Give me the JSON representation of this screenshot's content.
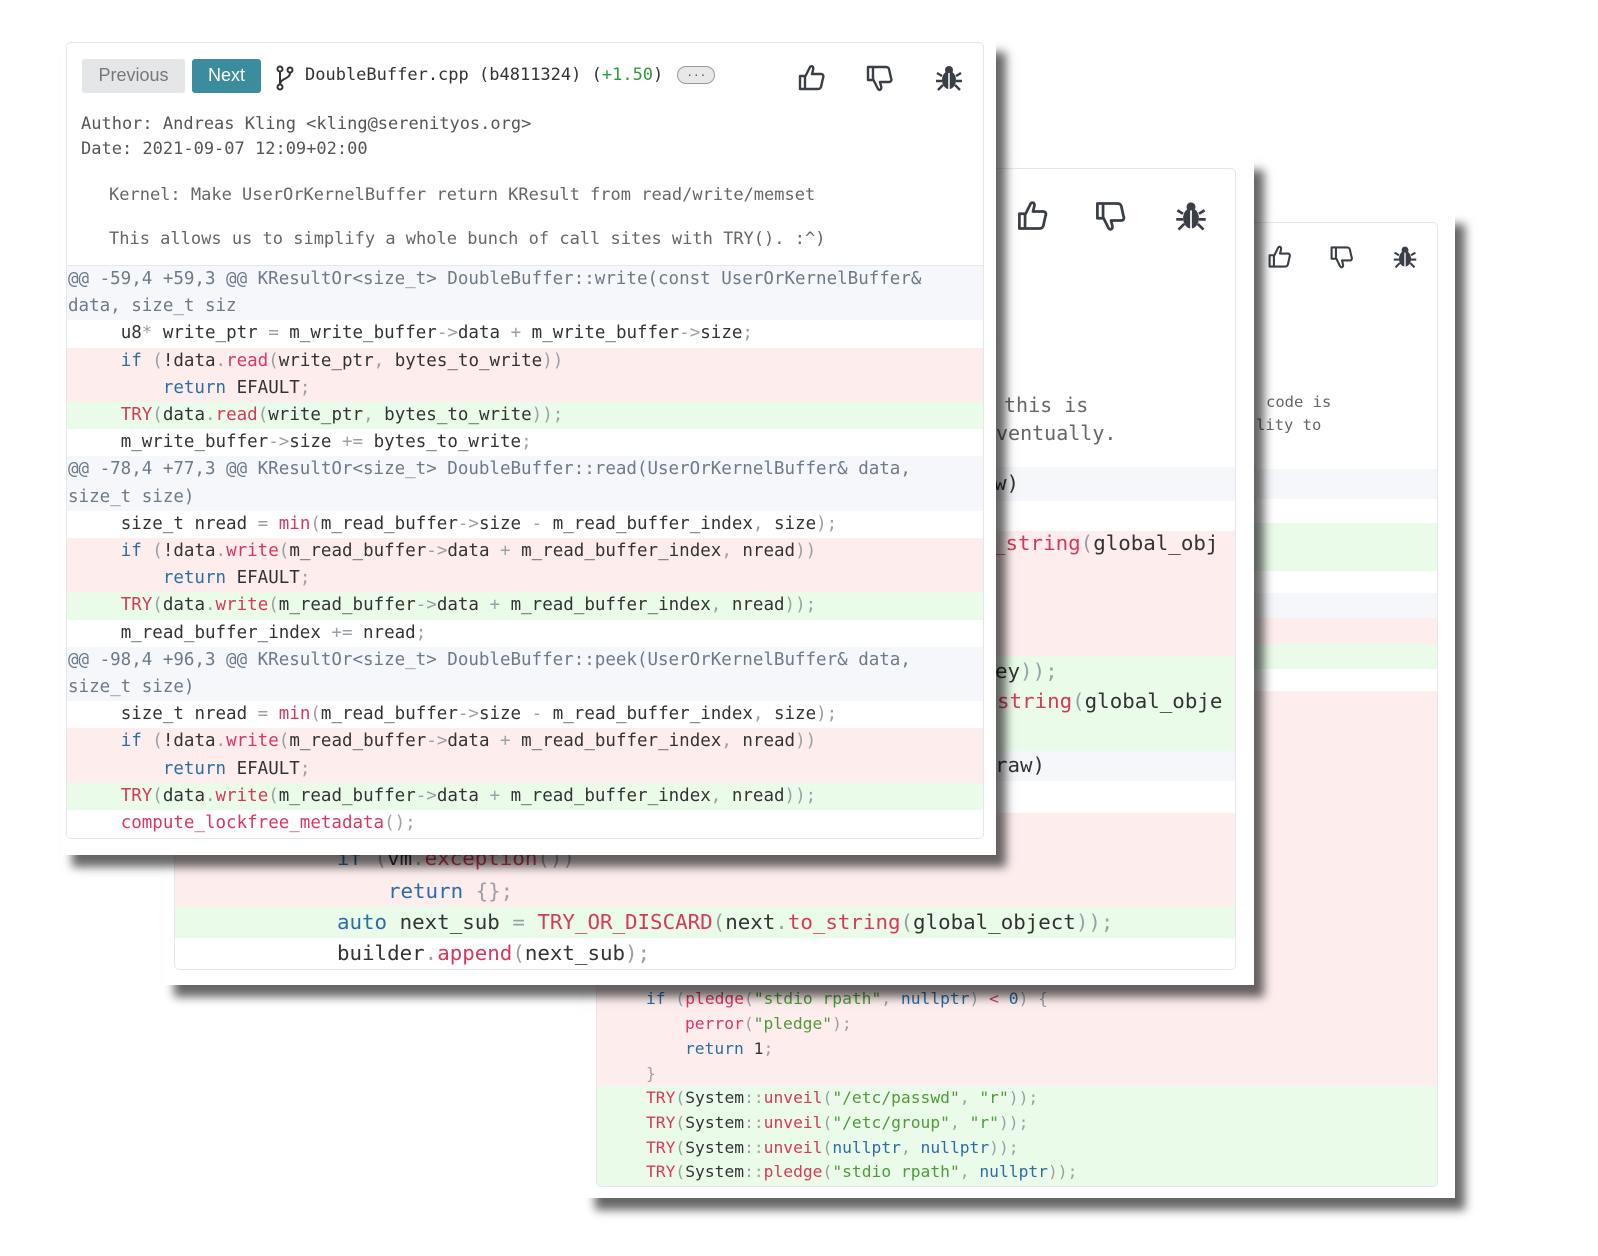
{
  "colors": {
    "accent": "#3b8c9c",
    "added_bg": "#ebfbea",
    "removed_bg": "#fdeded",
    "hunk_bg": "#f5f7fa",
    "keyword": "#2b6ea6",
    "function": "#d8385e",
    "string": "#4f9a3a",
    "score": "#2f9a3a"
  },
  "card1": {
    "prev_label": "Previous",
    "next_label": "Next",
    "branch_icon": "git-branch-icon",
    "file": "DoubleBuffer.cpp",
    "commit": "(b4811324)",
    "score": "+1.50",
    "more_label": "...",
    "icons": [
      "thumbs-up-icon",
      "thumbs-down-icon",
      "bug-icon"
    ],
    "author": "Author: Andreas Kling <kling@serenityos.org>",
    "date": "Date: 2021-09-07 12:09+02:00",
    "message": [
      "Kernel: Make UserOrKernelBuffer return KResult from read/write/memset",
      "This allows us to simplify a whole bunch of call sites with TRY(). :^)"
    ],
    "lines": [
      {
        "type": "hunk",
        "tokens": [
          [
            "@@ -59,4 +59,3 @@ KResultOr<size_t> DoubleBuffer::write(const UserOrKernelBuffer& data, size_t siz",
            ""
          ]
        ]
      },
      {
        "type": "ctx",
        "tokens": [
          [
            "     u8",
            ""
          ],
          [
            "*",
            "p"
          ],
          [
            " write_ptr ",
            ""
          ],
          [
            "=",
            "p"
          ],
          [
            " m_write_buffer",
            ""
          ],
          [
            "->",
            "p"
          ],
          [
            "data ",
            ""
          ],
          [
            "+",
            "p"
          ],
          [
            " m_write_buffer",
            ""
          ],
          [
            "->",
            "p"
          ],
          [
            "size",
            ""
          ],
          [
            ";",
            "p"
          ]
        ]
      },
      {
        "type": "del",
        "tokens": [
          [
            "     ",
            ""
          ],
          [
            "if",
            "k"
          ],
          [
            " (",
            "p"
          ],
          [
            "!data",
            ""
          ],
          [
            ".",
            "p"
          ],
          [
            "read",
            "f"
          ],
          [
            "(",
            "p"
          ],
          [
            "write_ptr",
            ""
          ],
          [
            ", ",
            "p"
          ],
          [
            "bytes_to_write",
            ""
          ],
          [
            "))",
            "p"
          ]
        ]
      },
      {
        "type": "del",
        "tokens": [
          [
            "         ",
            ""
          ],
          [
            "return",
            "k"
          ],
          [
            " EFAULT",
            ""
          ],
          [
            ";",
            "p"
          ]
        ]
      },
      {
        "type": "add",
        "tokens": [
          [
            "     ",
            ""
          ],
          [
            "TRY",
            "f"
          ],
          [
            "(",
            "p"
          ],
          [
            "data",
            ""
          ],
          [
            ".",
            "p"
          ],
          [
            "read",
            "f"
          ],
          [
            "(",
            "p"
          ],
          [
            "write_ptr",
            ""
          ],
          [
            ", ",
            "p"
          ],
          [
            "bytes_to_write",
            ""
          ],
          [
            "));",
            "p"
          ]
        ]
      },
      {
        "type": "ctx",
        "tokens": [
          [
            "     m_write_buffer",
            ""
          ],
          [
            "->",
            "p"
          ],
          [
            "size ",
            ""
          ],
          [
            "+=",
            "p"
          ],
          [
            " bytes_to_write",
            ""
          ],
          [
            ";",
            "p"
          ]
        ]
      },
      {
        "type": "hunk",
        "tokens": [
          [
            "@@ -78,4 +77,3 @@ KResultOr<size_t> DoubleBuffer::read(UserOrKernelBuffer& data, size_t size)",
            ""
          ]
        ]
      },
      {
        "type": "ctx",
        "tokens": [
          [
            "     size_t nread ",
            ""
          ],
          [
            "=",
            "p"
          ],
          [
            " ",
            ""
          ],
          [
            "min",
            "f"
          ],
          [
            "(",
            "p"
          ],
          [
            "m_read_buffer",
            ""
          ],
          [
            "->",
            "p"
          ],
          [
            "size ",
            ""
          ],
          [
            "-",
            "p"
          ],
          [
            " m_read_buffer_index",
            ""
          ],
          [
            ", ",
            "p"
          ],
          [
            "size",
            ""
          ],
          [
            ");",
            "p"
          ]
        ]
      },
      {
        "type": "del",
        "tokens": [
          [
            "     ",
            ""
          ],
          [
            "if",
            "k"
          ],
          [
            " (",
            "p"
          ],
          [
            "!data",
            ""
          ],
          [
            ".",
            "p"
          ],
          [
            "write",
            "f"
          ],
          [
            "(",
            "p"
          ],
          [
            "m_read_buffer",
            ""
          ],
          [
            "->",
            "p"
          ],
          [
            "data ",
            ""
          ],
          [
            "+",
            "p"
          ],
          [
            " m_read_buffer_index",
            ""
          ],
          [
            ", ",
            "p"
          ],
          [
            "nread",
            ""
          ],
          [
            "))",
            "p"
          ]
        ]
      },
      {
        "type": "del",
        "tokens": [
          [
            "         ",
            ""
          ],
          [
            "return",
            "k"
          ],
          [
            " EFAULT",
            ""
          ],
          [
            ";",
            "p"
          ]
        ]
      },
      {
        "type": "add",
        "tokens": [
          [
            "     ",
            ""
          ],
          [
            "TRY",
            "f"
          ],
          [
            "(",
            "p"
          ],
          [
            "data",
            ""
          ],
          [
            ".",
            "p"
          ],
          [
            "write",
            "f"
          ],
          [
            "(",
            "p"
          ],
          [
            "m_read_buffer",
            ""
          ],
          [
            "->",
            "p"
          ],
          [
            "data ",
            ""
          ],
          [
            "+",
            "p"
          ],
          [
            " m_read_buffer_index",
            ""
          ],
          [
            ", ",
            "p"
          ],
          [
            "nread",
            ""
          ],
          [
            "));",
            "p"
          ]
        ]
      },
      {
        "type": "ctx",
        "tokens": [
          [
            "     m_read_buffer_index ",
            ""
          ],
          [
            "+=",
            "p"
          ],
          [
            " nread",
            ""
          ],
          [
            ";",
            "p"
          ]
        ]
      },
      {
        "type": "hunk",
        "tokens": [
          [
            "@@ -98,4 +96,3 @@ KResultOr<size_t> DoubleBuffer::peek(UserOrKernelBuffer& data, size_t size)",
            ""
          ]
        ]
      },
      {
        "type": "ctx",
        "tokens": [
          [
            "     size_t nread ",
            ""
          ],
          [
            "=",
            "p"
          ],
          [
            " ",
            ""
          ],
          [
            "min",
            "f"
          ],
          [
            "(",
            "p"
          ],
          [
            "m_read_buffer",
            ""
          ],
          [
            "->",
            "p"
          ],
          [
            "size ",
            ""
          ],
          [
            "-",
            "p"
          ],
          [
            " m_read_buffer_index",
            ""
          ],
          [
            ", ",
            "p"
          ],
          [
            "size",
            ""
          ],
          [
            ");",
            "p"
          ]
        ]
      },
      {
        "type": "del",
        "tokens": [
          [
            "     ",
            ""
          ],
          [
            "if",
            "k"
          ],
          [
            " (",
            "p"
          ],
          [
            "!data",
            ""
          ],
          [
            ".",
            "p"
          ],
          [
            "write",
            "f"
          ],
          [
            "(",
            "p"
          ],
          [
            "m_read_buffer",
            ""
          ],
          [
            "->",
            "p"
          ],
          [
            "data ",
            ""
          ],
          [
            "+",
            "p"
          ],
          [
            " m_read_buffer_index",
            ""
          ],
          [
            ", ",
            "p"
          ],
          [
            "nread",
            ""
          ],
          [
            "))",
            "p"
          ]
        ]
      },
      {
        "type": "del",
        "tokens": [
          [
            "         ",
            ""
          ],
          [
            "return",
            "k"
          ],
          [
            " EFAULT",
            ""
          ],
          [
            ";",
            "p"
          ]
        ]
      },
      {
        "type": "add",
        "tokens": [
          [
            "     ",
            ""
          ],
          [
            "TRY",
            "f"
          ],
          [
            "(",
            "p"
          ],
          [
            "data",
            ""
          ],
          [
            ".",
            "p"
          ],
          [
            "write",
            "f"
          ],
          [
            "(",
            "p"
          ],
          [
            "m_read_buffer",
            ""
          ],
          [
            "->",
            "p"
          ],
          [
            "data ",
            ""
          ],
          [
            "+",
            "p"
          ],
          [
            " m_read_buffer_index",
            ""
          ],
          [
            ", ",
            "p"
          ],
          [
            "nread",
            ""
          ],
          [
            "));",
            "p"
          ]
        ]
      },
      {
        "type": "ctx",
        "tokens": [
          [
            "     ",
            ""
          ],
          [
            "compute_lockfree_metadata",
            "f"
          ],
          [
            "();",
            "p"
          ]
        ]
      }
    ]
  },
  "card2": {
    "icons": [
      "thumbs-up-icon",
      "thumbs-down-icon",
      "bug-icon"
    ],
    "message_fragments": [
      [
        [
          "this is",
          ""
        ]
      ],
      [
        [
          "ventually.",
          ""
        ]
      ]
    ],
    "fragments": [
      [
        [
          "w)",
          ""
        ]
      ],
      [
        [
          "_string",
          "f"
        ],
        [
          "(",
          "p"
        ],
        [
          "global_obj",
          ""
        ]
      ],
      [
        [
          "ey",
          ""
        ],
        [
          "));",
          "p"
        ]
      ],
      [
        [
          "string",
          "f"
        ],
        [
          "(",
          "p"
        ],
        [
          "global_obje",
          ""
        ]
      ],
      [
        [
          "raw)",
          ""
        ]
      ],
      [
        [
          "if",
          "k"
        ],
        [
          " (",
          "p"
        ],
        [
          "vm",
          ""
        ],
        [
          ".",
          "p"
        ],
        [
          "exception",
          "f"
        ],
        [
          "())",
          "p"
        ]
      ],
      [
        [
          "return",
          "k"
        ],
        [
          " {};",
          "p"
        ]
      ],
      [
        [
          "auto",
          "k"
        ],
        [
          " next_sub ",
          ""
        ],
        [
          "=",
          "p"
        ],
        [
          " ",
          ""
        ],
        [
          "TRY_OR_DISCARD",
          "f"
        ],
        [
          "(",
          "p"
        ],
        [
          "next",
          ""
        ],
        [
          ".",
          "p"
        ],
        [
          "to_string",
          "f"
        ],
        [
          "(",
          "p"
        ],
        [
          "global_object",
          ""
        ],
        [
          "));",
          "p"
        ]
      ],
      [
        [
          "builder",
          ""
        ],
        [
          ".",
          "p"
        ],
        [
          "append",
          "f"
        ],
        [
          "(",
          "p"
        ],
        [
          "next_sub",
          ""
        ],
        [
          ");",
          "p"
        ]
      ]
    ]
  },
  "card3": {
    "icons": [
      "thumbs-up-icon",
      "thumbs-down-icon",
      "bug-icon"
    ],
    "message_fragments": [
      [
        [
          "code is",
          ""
        ]
      ],
      [
        [
          "lity to",
          ""
        ]
      ]
    ],
    "fragments": [
      [
        [
          "if",
          "k"
        ],
        [
          " (",
          "p"
        ],
        [
          "pledge",
          "f"
        ],
        [
          "(",
          "p"
        ],
        [
          "\"stdio rpath\"",
          "s"
        ],
        [
          ", ",
          "p"
        ],
        [
          "nullptr",
          "k"
        ],
        [
          ") ",
          "p"
        ],
        [
          "<",
          "f"
        ],
        [
          " ",
          ""
        ],
        [
          "0",
          "k"
        ],
        [
          ") {",
          "p"
        ]
      ],
      [
        [
          "perror",
          "f"
        ],
        [
          "(",
          "p"
        ],
        [
          "\"pledge\"",
          "s"
        ],
        [
          ");",
          "p"
        ]
      ],
      [
        [
          "return",
          "k"
        ],
        [
          " 1",
          ""
        ],
        [
          ";",
          "p"
        ]
      ],
      [
        [
          "}",
          "p"
        ]
      ],
      [
        [
          "TRY",
          "f"
        ],
        [
          "(",
          "p"
        ],
        [
          "System",
          ""
        ],
        [
          "::",
          "p"
        ],
        [
          "unveil",
          "f"
        ],
        [
          "(",
          "p"
        ],
        [
          "\"/etc/passwd\"",
          "s"
        ],
        [
          ", ",
          "p"
        ],
        [
          "\"r\"",
          "s"
        ],
        [
          "));",
          "p"
        ]
      ],
      [
        [
          "TRY",
          "f"
        ],
        [
          "(",
          "p"
        ],
        [
          "System",
          ""
        ],
        [
          "::",
          "p"
        ],
        [
          "unveil",
          "f"
        ],
        [
          "(",
          "p"
        ],
        [
          "\"/etc/group\"",
          "s"
        ],
        [
          ", ",
          "p"
        ],
        [
          "\"r\"",
          "s"
        ],
        [
          "));",
          "p"
        ]
      ],
      [
        [
          "TRY",
          "f"
        ],
        [
          "(",
          "p"
        ],
        [
          "System",
          ""
        ],
        [
          "::",
          "p"
        ],
        [
          "unveil",
          "f"
        ],
        [
          "(",
          "p"
        ],
        [
          "nullptr",
          "k"
        ],
        [
          ", ",
          "p"
        ],
        [
          "nullptr",
          "k"
        ],
        [
          "));",
          "p"
        ]
      ],
      [
        [
          "TRY",
          "f"
        ],
        [
          "(",
          "p"
        ],
        [
          "System",
          ""
        ],
        [
          "::",
          "p"
        ],
        [
          "pledge",
          "f"
        ],
        [
          "(",
          "p"
        ],
        [
          "\"stdio rpath\"",
          "s"
        ],
        [
          ", ",
          "p"
        ],
        [
          "nullptr",
          "k"
        ],
        [
          "));",
          "p"
        ]
      ]
    ]
  }
}
